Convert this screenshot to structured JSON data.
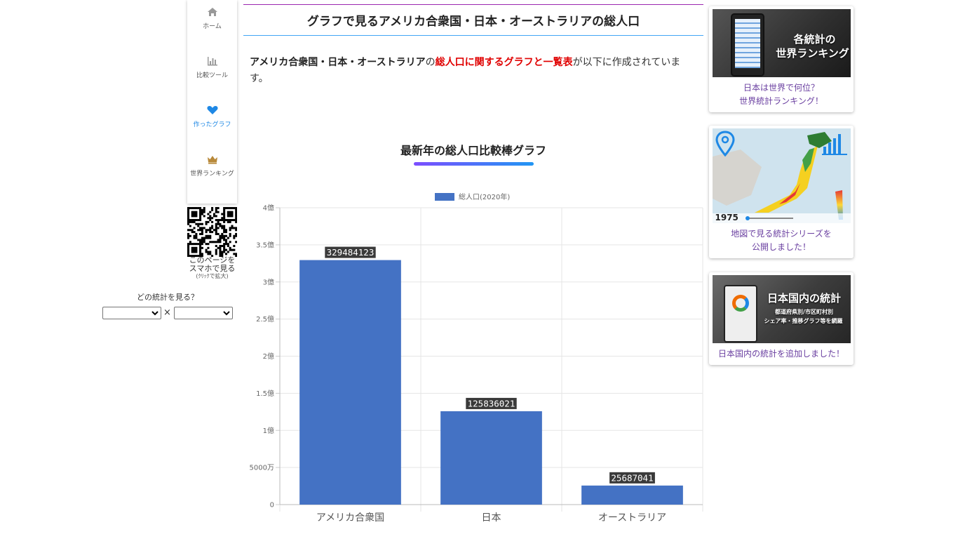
{
  "nav": {
    "items": [
      {
        "label": "ホーム",
        "icon": "home-icon"
      },
      {
        "label": "比較ツール",
        "icon": "bar-chart-icon"
      },
      {
        "label": "作ったグラフ",
        "icon": "heart-icon"
      },
      {
        "label": "世界ランキング",
        "icon": "crown-icon"
      }
    ],
    "qr_caption_line1": "このページを",
    "qr_caption_line2": "スマホで見る",
    "qr_caption_small": "(ｸﾘｯｸで拡大)",
    "which_label": "どの統計を見る？",
    "select_separator": "×",
    "select1_value": "",
    "select2_value": ""
  },
  "main": {
    "title": "グラフで見るアメリカ合衆国・日本・オーストラリアの総人口",
    "intro_bold": "アメリカ合衆国・日本・オーストラリア",
    "intro_mid": "の",
    "intro_red": "総人口に関するグラフと一覧表",
    "intro_tail": "が以下に作成されています。",
    "chart_heading": "最新年の総人口比較棒グラフ"
  },
  "chart_data": {
    "type": "bar",
    "categories": [
      "アメリカ合衆国",
      "日本",
      "オーストラリア"
    ],
    "series": [
      {
        "name": "総人口(2020年)",
        "values": [
          329484123,
          125836021,
          25687041
        ]
      }
    ],
    "data_labels": [
      "329484123",
      "125836021",
      "25687041"
    ],
    "ylim": [
      0,
      400000000
    ],
    "yticks": [
      0,
      50000000,
      100000000,
      150000000,
      200000000,
      250000000,
      300000000,
      350000000,
      400000000
    ],
    "ytick_labels": [
      "0",
      "5000万",
      "1億",
      "1.5億",
      "2億",
      "2.5億",
      "3億",
      "3.5億",
      "4億"
    ],
    "legend_position": "top",
    "grid": true,
    "bar_color": "#4472c4"
  },
  "sidebar": {
    "cards": [
      {
        "image_title": "各統計の",
        "image_title2": "世界ランキング",
        "caption1": "日本は世界で何位？",
        "caption2": "世界統計ランキング！"
      },
      {
        "image_label": "1975",
        "caption1": "地図で見る統計シリーズを",
        "caption2": "公開しました！"
      },
      {
        "image_title": "日本国内の統計",
        "image_sub1": "都道府県別/市区町村別",
        "image_sub2": "シェア率・推移グラフ等を網羅",
        "caption1": "日本国内の統計を追加しました！"
      }
    ]
  }
}
